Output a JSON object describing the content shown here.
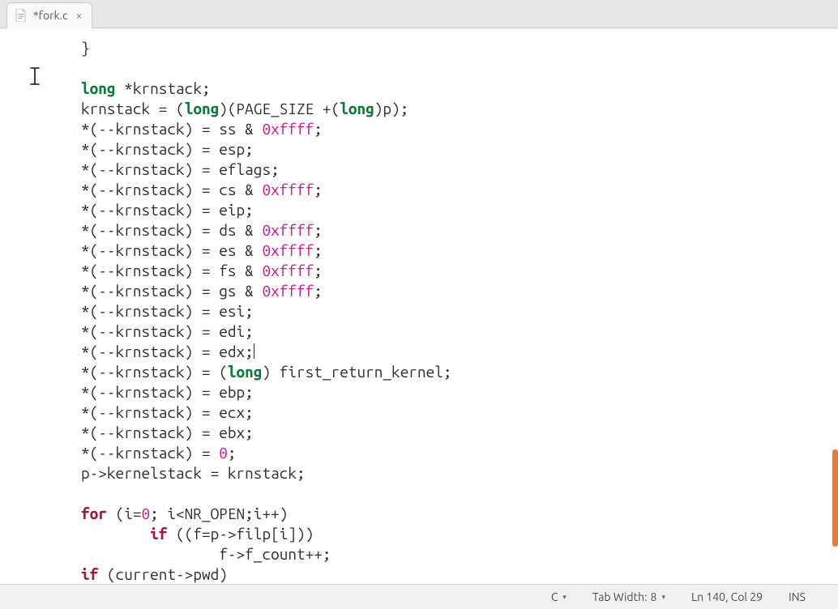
{
  "tab": {
    "filename": "*fork.c",
    "close_glyph": "×"
  },
  "statusbar": {
    "language": "C",
    "tabwidth_label": "Tab Width:",
    "tabwidth_value": "8",
    "cursor_pos": "Ln 140, Col 29",
    "insert_mode": "INS"
  },
  "code": {
    "tokens": [
      [
        {
          "t": "}",
          "c": ""
        }
      ],
      [],
      [
        {
          "t": "long",
          "c": "kw"
        },
        {
          "t": " *krnstack;",
          "c": ""
        }
      ],
      [
        {
          "t": "krnstack = (",
          "c": ""
        },
        {
          "t": "long",
          "c": "kw"
        },
        {
          "t": ")(PAGE_SIZE +(",
          "c": ""
        },
        {
          "t": "long",
          "c": "kw"
        },
        {
          "t": ")p);",
          "c": ""
        }
      ],
      [
        {
          "t": "*(--krnstack) = ss & ",
          "c": ""
        },
        {
          "t": "0xffff",
          "c": "hex"
        },
        {
          "t": ";",
          "c": ""
        }
      ],
      [
        {
          "t": "*(--krnstack) = esp;",
          "c": ""
        }
      ],
      [
        {
          "t": "*(--krnstack) = eflags;",
          "c": ""
        }
      ],
      [
        {
          "t": "*(--krnstack) = cs & ",
          "c": ""
        },
        {
          "t": "0xffff",
          "c": "hex"
        },
        {
          "t": ";",
          "c": ""
        }
      ],
      [
        {
          "t": "*(--krnstack) = eip;",
          "c": ""
        }
      ],
      [
        {
          "t": "*(--krnstack) = ds & ",
          "c": ""
        },
        {
          "t": "0xffff",
          "c": "hex"
        },
        {
          "t": ";",
          "c": ""
        }
      ],
      [
        {
          "t": "*(--krnstack) = es & ",
          "c": ""
        },
        {
          "t": "0xffff",
          "c": "hex"
        },
        {
          "t": ";",
          "c": ""
        }
      ],
      [
        {
          "t": "*(--krnstack) = fs & ",
          "c": ""
        },
        {
          "t": "0xffff",
          "c": "hex"
        },
        {
          "t": ";",
          "c": ""
        }
      ],
      [
        {
          "t": "*(--krnstack) = gs & ",
          "c": ""
        },
        {
          "t": "0xffff",
          "c": "hex"
        },
        {
          "t": ";",
          "c": ""
        }
      ],
      [
        {
          "t": "*(--krnstack) = esi;",
          "c": ""
        }
      ],
      [
        {
          "t": "*(--krnstack) = edi;",
          "c": ""
        }
      ],
      [
        {
          "t": "*(--krnstack) = edx;",
          "c": ""
        },
        {
          "t": "",
          "c": "cursor"
        }
      ],
      [
        {
          "t": "*(--krnstack) = (",
          "c": ""
        },
        {
          "t": "long",
          "c": "kw"
        },
        {
          "t": ") first_return_kernel;",
          "c": ""
        }
      ],
      [
        {
          "t": "*(--krnstack) = ebp;",
          "c": ""
        }
      ],
      [
        {
          "t": "*(--krnstack) = ecx;",
          "c": ""
        }
      ],
      [
        {
          "t": "*(--krnstack) = ebx;",
          "c": ""
        }
      ],
      [
        {
          "t": "*(--krnstack) = ",
          "c": ""
        },
        {
          "t": "0",
          "c": "hex"
        },
        {
          "t": ";",
          "c": ""
        }
      ],
      [
        {
          "t": "p->kernelstack = krnstack;",
          "c": ""
        }
      ],
      [],
      [
        {
          "t": "for",
          "c": "kw2"
        },
        {
          "t": " (i=",
          "c": ""
        },
        {
          "t": "0",
          "c": "hex"
        },
        {
          "t": "; i<NR_OPEN;i++)",
          "c": ""
        }
      ],
      [
        {
          "t": "        ",
          "c": ""
        },
        {
          "t": "if",
          "c": "kw2"
        },
        {
          "t": " ((f=p->filp[i]))",
          "c": ""
        }
      ],
      [
        {
          "t": "                f->f_count++;",
          "c": ""
        }
      ],
      [
        {
          "t": "if",
          "c": "kw2"
        },
        {
          "t": " (current->pwd)",
          "c": ""
        }
      ]
    ]
  }
}
